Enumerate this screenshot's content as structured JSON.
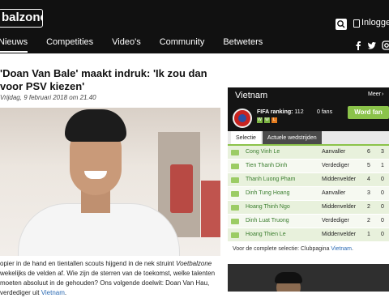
{
  "header": {
    "logo": "balzone",
    "login_label": "Inloggen",
    "nav": [
      "Nieuws",
      "Competities",
      "Video's",
      "Community",
      "Betweters"
    ]
  },
  "article": {
    "title": "'Doan Van Bale' maakt indruk: 'Ik zou dan voor PSV kiezen'",
    "date": "Vrijdag, 9 februari 2018 om 21.40",
    "photo_description": "Smiling young man with black hair in white shirt",
    "body_part1": "opier in de hand en tientallen scouts hijgend in de nek struint ",
    "body_em": "Voetbalzone",
    "body_part2": " wekelijks de velden af. Wie zijn de sterren van de toekomst, welke talenten moeten absoluut in de gehouden? Ons volgende doelwit: Doan Van Hau, verdediger uit ",
    "body_link": "Vietnam",
    "body_end": "."
  },
  "widget": {
    "title": "Vietnam",
    "more": "Meer",
    "fifa_label": "FIFA ranking:",
    "fifa_value": "112",
    "form": [
      "W",
      "W",
      "L"
    ],
    "fans": "0 fans",
    "fan_button": "Word fan",
    "tabs": [
      "Selectie",
      "Actuele wedstrijden"
    ],
    "players": [
      {
        "name": "Cong Vinh Le",
        "position": "Aanvaller",
        "c1": "6",
        "c2": "3"
      },
      {
        "name": "Tien Thanh Dinh",
        "position": "Verdediger",
        "c1": "5",
        "c2": "1"
      },
      {
        "name": "Thanh Luong Pham",
        "position": "Middenvelder",
        "c1": "4",
        "c2": "0"
      },
      {
        "name": "Dinh Tung Hoang",
        "position": "Aanvaller",
        "c1": "3",
        "c2": "0"
      },
      {
        "name": "Hoang Thinh Ngo",
        "position": "Middenvelder",
        "c1": "2",
        "c2": "0"
      },
      {
        "name": "Dinh Luat Truong",
        "position": "Verdediger",
        "c1": "2",
        "c2": "0"
      },
      {
        "name": "Hoang Thien Le",
        "position": "Middenvelder",
        "c1": "1",
        "c2": "0"
      }
    ],
    "footer_text": "Voor de complete selectie: Clubpagina ",
    "footer_link": "Vietnam",
    "footer_end": "."
  },
  "colors": {
    "accent": "#8bc34a",
    "header_bg": "#111111",
    "link": "#2a6ab3"
  }
}
